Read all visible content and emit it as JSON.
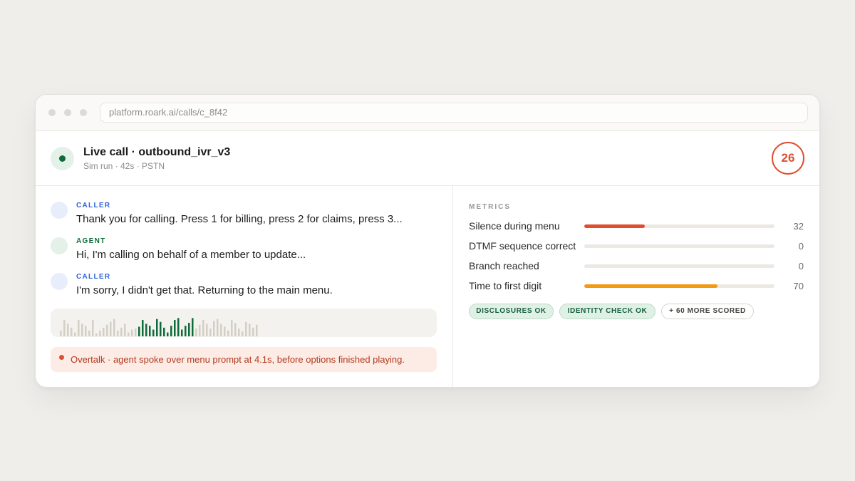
{
  "browser": {
    "url": "platform.roark.ai/calls/c_8f42"
  },
  "call": {
    "title": "Live call · outbound_ivr_v3",
    "subtitle": "Sim run · 42s · PSTN",
    "score": "26",
    "status_color": "#0f6b3a"
  },
  "transcript": [
    {
      "role": "CALLER",
      "text": "Thank you for calling. Press 1 for billing, press 2 for claims, press 3..."
    },
    {
      "role": "AGENT",
      "text": "Hi, I'm calling on behalf of a member to update..."
    },
    {
      "role": "CALLER",
      "text": "I'm sorry, I didn't get that. Returning to the main menu."
    }
  ],
  "waveform": {
    "levels": [
      0.3,
      0.85,
      0.65,
      0.45,
      0.2,
      0.85,
      0.65,
      0.55,
      0.3,
      0.85,
      0.15,
      0.3,
      0.45,
      0.6,
      0.75,
      0.9,
      0.3,
      0.45,
      0.65,
      0.2,
      0.35,
      0.4,
      0.5,
      0.85,
      0.65,
      0.55,
      0.35,
      0.9,
      0.75,
      0.45,
      0.2,
      0.55,
      0.85,
      0.95,
      0.35,
      0.55,
      0.7,
      0.95,
      0.4,
      0.6,
      0.85,
      0.65,
      0.4,
      0.8,
      0.9,
      0.65,
      0.5,
      0.3,
      0.85,
      0.7,
      0.4,
      0.25,
      0.75,
      0.65,
      0.45,
      0.6
    ],
    "active_range": [
      22,
      37
    ],
    "idle_color": "#d4cfc5",
    "active_color": "#0f6b3a"
  },
  "alert": {
    "text": "Overtalk · agent spoke over menu prompt at 4.1s, before options finished playing."
  },
  "metrics": {
    "label": "METRICS",
    "items": [
      {
        "name": "Silence during menu",
        "value": 32,
        "display": "32",
        "color": "#e04e2f"
      },
      {
        "name": "DTMF sequence correct",
        "value": 0,
        "display": "0",
        "color": "#e04e2f"
      },
      {
        "name": "Branch reached",
        "value": 0,
        "display": "0",
        "color": "#e04e2f"
      },
      {
        "name": "Time to first digit",
        "value": 70,
        "display": "70",
        "color": "#f29b12"
      }
    ]
  },
  "chips": [
    {
      "label": "DISCLOSURES OK",
      "kind": "ok"
    },
    {
      "label": "IDENTITY CHECK OK",
      "kind": "ok"
    },
    {
      "label": "+ 60 MORE SCORED",
      "kind": "more"
    }
  ]
}
